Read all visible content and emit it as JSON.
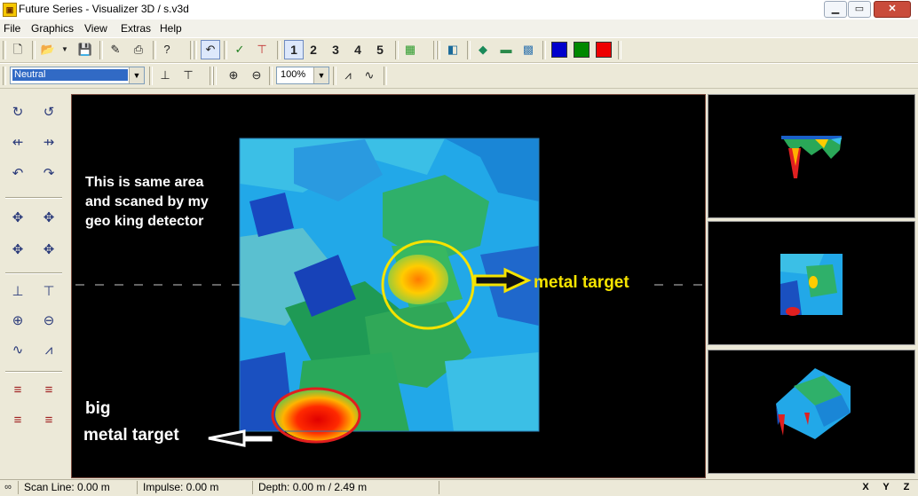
{
  "window": {
    "title": "Future Series - Visualizer 3D / s.v3d",
    "minimize": "▁",
    "maximize": "▭",
    "close": "✕"
  },
  "menu": [
    "File",
    "Graphics",
    "View",
    "Extras",
    "Help"
  ],
  "toolbar": {
    "numbers": [
      "1",
      "2",
      "3",
      "4",
      "5"
    ],
    "color_swatches": [
      "#0000cc",
      "#008800",
      "#ee0000"
    ]
  },
  "toolbar2": {
    "palette_value": "Neutral",
    "zoom_value": "100%"
  },
  "annotations": {
    "description": "This is same area\nand scaned by my\ngeo king detector",
    "metal_target": "metal target",
    "big_metal_target_line1": "big",
    "big_metal_target_line2": "metal target",
    "circle_colors": {
      "yellow": "#f5e300",
      "red": "#e01e1e"
    }
  },
  "status": {
    "scan_line": "Scan Line: 0.00 m",
    "impulse": "Impulse: 0.00 m",
    "depth": "Depth: 0.00 m / 2.49 m",
    "axes": [
      "X",
      "Y",
      "Z"
    ]
  }
}
